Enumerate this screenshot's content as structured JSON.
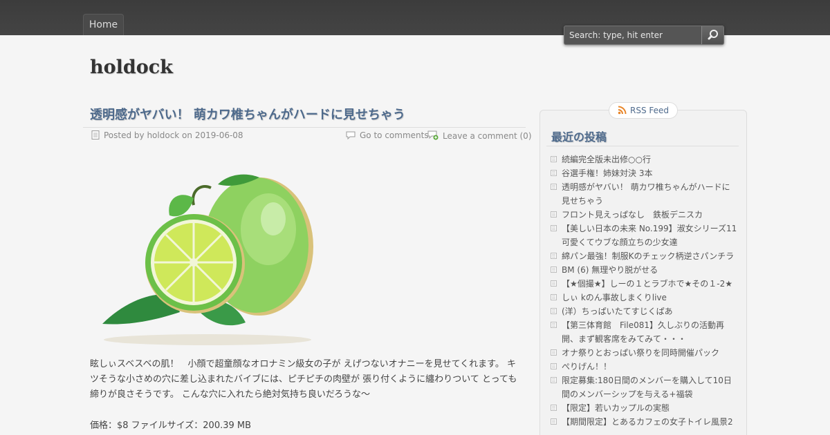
{
  "nav": {
    "home_label": "Home"
  },
  "search": {
    "placeholder": "Search: type, hit enter"
  },
  "site": {
    "title": "holdock"
  },
  "post": {
    "title": "透明感がヤバい！ 萌カワ椎ちゃんがハードに見せちゃう",
    "posted_by": "Posted by holdock on 2019-06-08",
    "go_to_comments": "Go to comments",
    "leave_comment": "Leave a comment (0)",
    "body": "眩しぃスベスベの肌！　小顔で超童顔なオロナミン級女の子が えげつないオナニーを見せてくれます。 キツそうな小さめの穴に差し込まれたバイブには、ピチピチの肉壁が 張り付くように纏わりついて とっても締りが良さそうです。 こんな穴に入れたら絶対気持ち良いだろうな～",
    "price": "価格：$8 ファイルサイズ：200.39 MB"
  },
  "sidebar": {
    "rss_label": "RSS Feed",
    "recent_title": "最近の投稿",
    "recent_posts": [
      "続編完全版未出修○○行",
      "谷選手権！姉妹対決 3本",
      "透明感がヤバい！ 萌カワ椎ちゃんがハードに見せちゃう",
      "フロント見えっぱなし　鉄板デニスカ",
      "【美しい日本の未来 No.199】淑女シリーズ11　可愛くてウブな顔立ちの少女達",
      "綿パン最強！制服Kのチェック柄逆さパンチラ",
      "BM (6) 無理やり脱がせる",
      "【★個撮★】しーの１とラブホで★その１-2★",
      "しぃ kのん事故しまくりlive",
      "(洋）ちっぱいたてすじくぱあ",
      "【第三体育館　File081】久しぶりの活動再開、まず観客席をみてみて・・・",
      "オナ祭りとおっぱい祭りを同時開催パック",
      "ぺりげん！！",
      "限定募集:180日間のメンバーを購入して10日間のメンバーシップを与える+福袋",
      "【限定】若いカップルの実態",
      "【期間限定】とあるカフェの女子トイレ風景2"
    ]
  },
  "colors": {
    "topbar": "#3c3c3c",
    "link": "#4e6a8c",
    "background": "#f5f5f5"
  }
}
